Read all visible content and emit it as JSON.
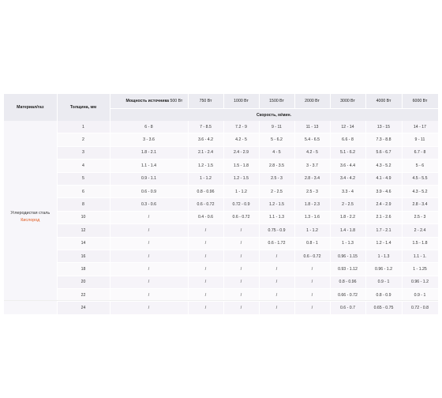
{
  "header": {
    "material": "Материал/газ",
    "thickness": "Толщина, мм",
    "power_label": "Мощность источника",
    "power_first": "500 Вт",
    "powers": [
      "750 Вт",
      "1000 Вт",
      "1500 Вт",
      "2000 Вт",
      "3000 Вт",
      "4000 Вт",
      "6000 Вт"
    ],
    "speed_label": "Скорость, м/мин."
  },
  "material": {
    "name": "Углеродистая сталь",
    "gas": "Кислород",
    "gas_color": "#e0581c"
  },
  "rows": [
    {
      "t": "1",
      "v": [
        "6 - 8",
        "7 - 8.5",
        "7.2 - 9",
        "9 - 11",
        "11 - 13",
        "12 - 14",
        "13 - 15",
        "14 - 17"
      ]
    },
    {
      "t": "2",
      "v": [
        "3 - 3.6",
        "3.6 - 4.2",
        "4.2 - 5",
        "5 - 6.2",
        "5.4 - 6.5",
        "6.6 - 8",
        "7.3 - 8.8",
        "9 - 11"
      ]
    },
    {
      "t": "3",
      "v": [
        "1.8 - 2.1",
        "2.1 - 2.4",
        "2.4 - 2.9",
        "4 - 5",
        "4.2 - 5",
        "5.1 - 6.2",
        "5.6 - 6.7",
        "6.7 - 8"
      ]
    },
    {
      "t": "4",
      "v": [
        "1.1 - 1.4",
        "1.2 - 1.5",
        "1.5 - 1.8",
        "2.8 - 3.5",
        "3 - 3.7",
        "3.6 - 4.4",
        "4.3 - 5.2",
        "5 - 6"
      ]
    },
    {
      "t": "5",
      "v": [
        "0.9 - 1.1",
        "1 - 1.2",
        "1.2 - 1.5",
        "2.5 - 3",
        "2.8 - 3.4",
        "3.4 - 4.2",
        "4.1 - 4.9",
        "4.5 - 5.5"
      ]
    },
    {
      "t": "6",
      "v": [
        "0.6 - 0.9",
        "0.8 - 0.96",
        "1 - 1.2",
        "2 - 2.5",
        "2.5 - 3",
        "3.3 - 4",
        "3.9 - 4.6",
        "4.3 - 5.2"
      ]
    },
    {
      "t": "8",
      "v": [
        "0.3 - 0.6",
        "0.6 - 0.72",
        "0.72 - 0.9",
        "1.2 - 1.5",
        "1.8 - 2.3",
        "2 - 2.5",
        "2.4 - 2.9",
        "2.8 - 3.4"
      ]
    },
    {
      "t": "10",
      "v": [
        "/",
        "0.4 - 0.6",
        "0.6 - 0.72",
        "1.1 - 1.3",
        "1.3 - 1.6",
        "1.8 - 2.2",
        "2.1 - 2.6",
        "2.5 - 3"
      ]
    },
    {
      "t": "12",
      "v": [
        "/",
        "/",
        "/",
        "0.75 - 0.9",
        "1 - 1.2",
        "1.4 - 1.8",
        "1.7 - 2.1",
        "2 - 2.4"
      ]
    },
    {
      "t": "14",
      "v": [
        "/",
        "/",
        "/",
        "0.6 - 1.72",
        "0.8 - 1",
        "1 - 1.3",
        "1.2 - 1.4",
        "1.5 - 1.8"
      ]
    },
    {
      "t": "16",
      "v": [
        "/",
        "/",
        "/",
        "/",
        "0.6 - 0.72",
        "0.96 - 1.15",
        "1 - 1.3",
        "1.1 - 1."
      ]
    },
    {
      "t": "18",
      "v": [
        "/",
        "/",
        "/",
        "/",
        "/",
        "0.93 - 1.12",
        "0.96 - 1.2",
        "1 - 1.25"
      ]
    },
    {
      "t": "20",
      "v": [
        "/",
        "/",
        "/",
        "/",
        "/",
        "0.8 - 0.96",
        "0.9 - 1",
        "0.96 - 1.2"
      ]
    },
    {
      "t": "22",
      "v": [
        "/",
        "/",
        "/",
        "/",
        "/",
        "0.66 - 0.72",
        "0.8 - 0.9",
        "0.9 - 1"
      ]
    },
    {
      "t": "24",
      "v": [
        "/",
        "/",
        "/",
        "/",
        "/",
        "0.6 - 0.7",
        "0.65 - 0.75",
        "0.72 - 0.8"
      ]
    }
  ]
}
